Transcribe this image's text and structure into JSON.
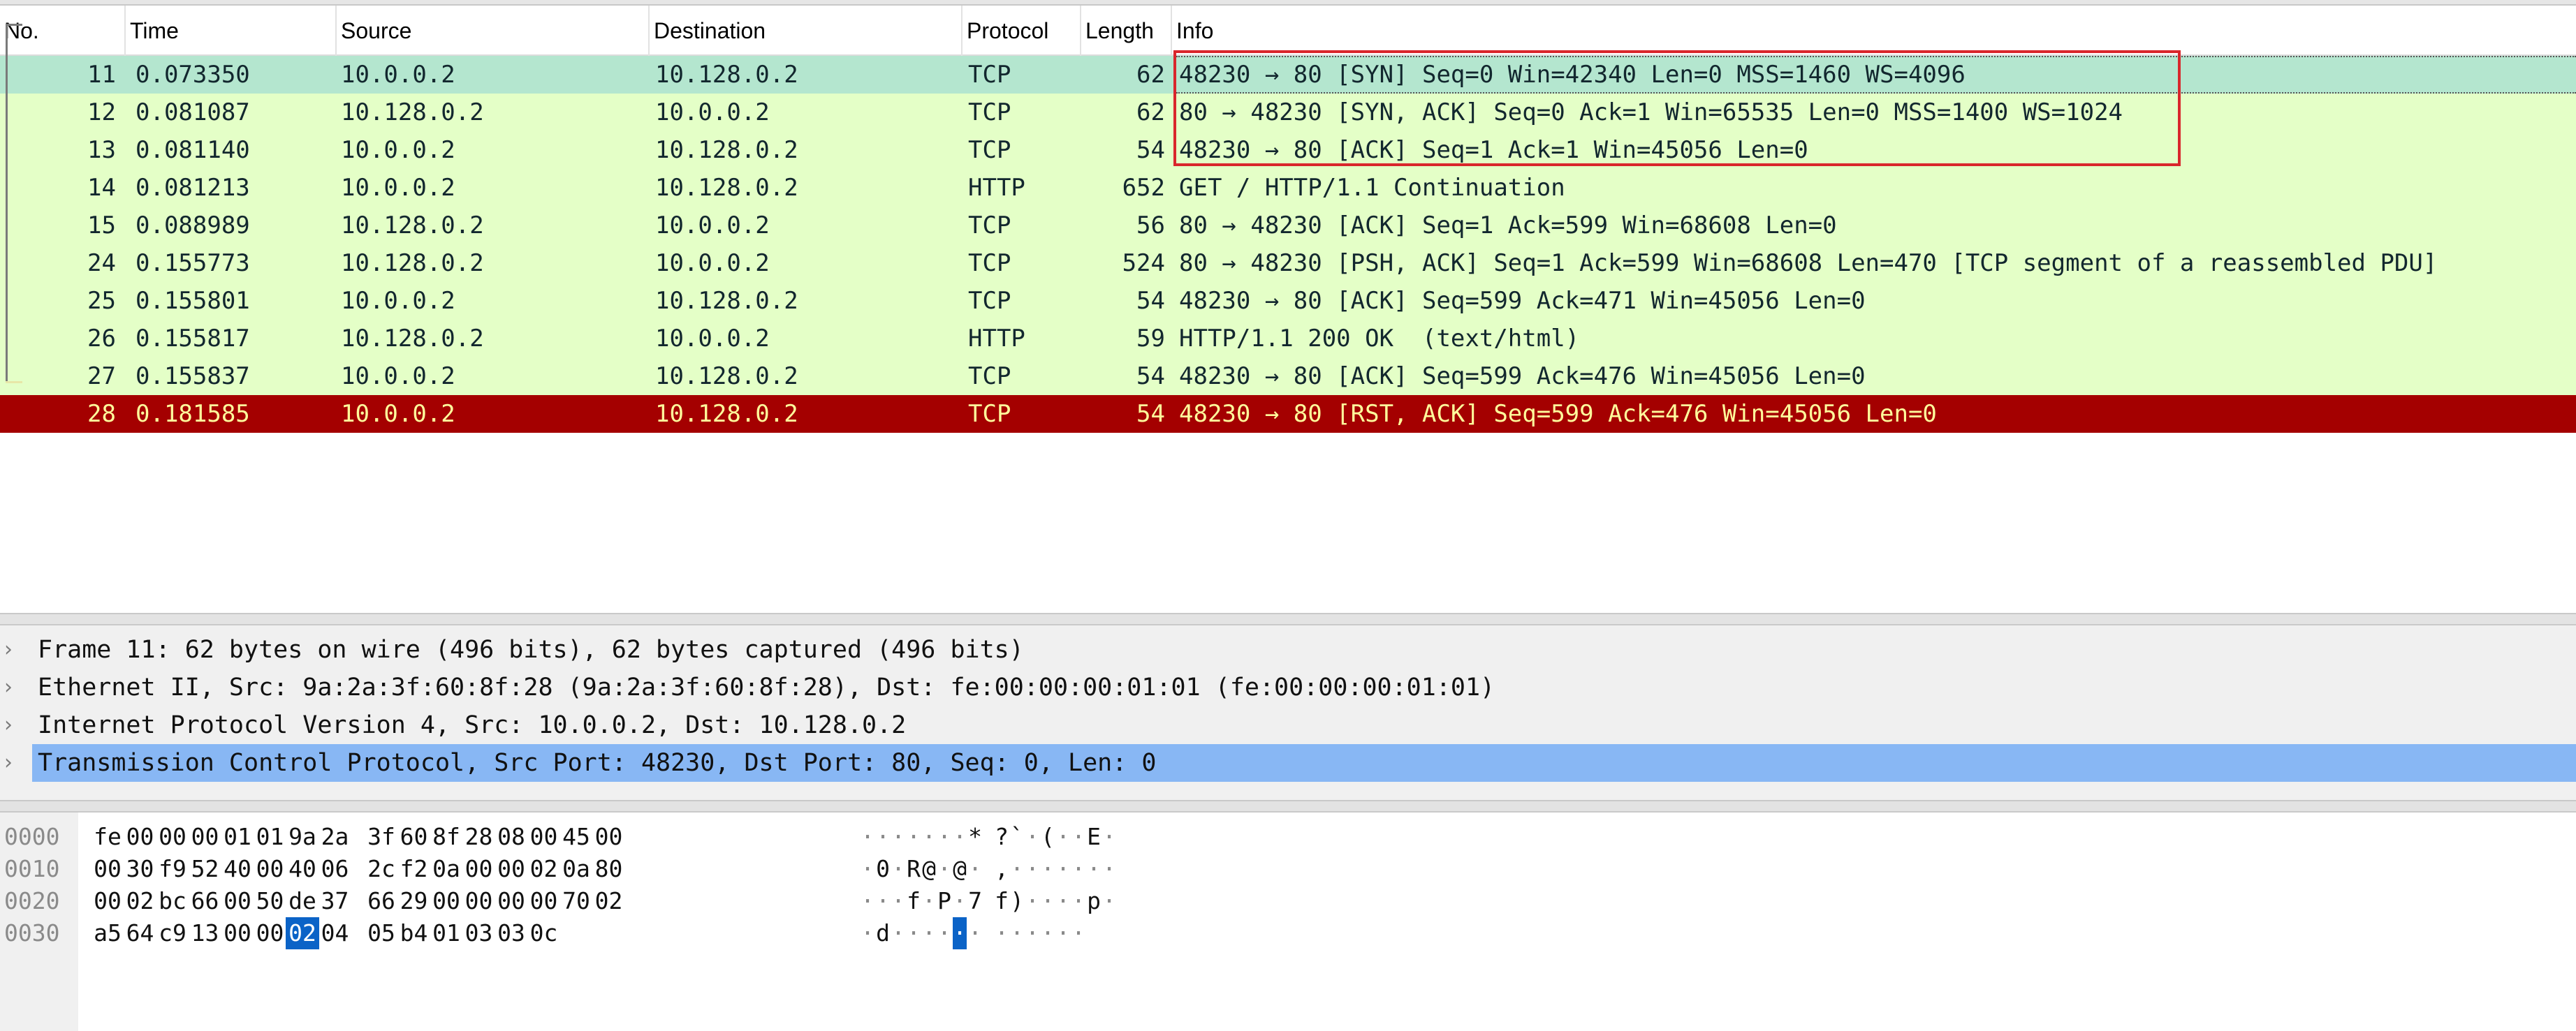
{
  "columns": [
    "No.",
    "Time",
    "Source",
    "Destination",
    "Protocol",
    "Length",
    "Info"
  ],
  "packets": [
    {
      "no": "11",
      "time": "0.073350",
      "src": "10.0.0.2",
      "dst": "10.128.0.2",
      "proto": "TCP",
      "len": "62",
      "info": "48230 → 80 [SYN] Seq=0 Win=42340 Len=0 MSS=1460 WS=4096",
      "state": "selected"
    },
    {
      "no": "12",
      "time": "0.081087",
      "src": "10.128.0.2",
      "dst": "10.0.0.2",
      "proto": "TCP",
      "len": "62",
      "info": "80 → 48230 [SYN, ACK] Seq=0 Ack=1 Win=65535 Len=0 MSS=1400 WS=1024",
      "state": "normal"
    },
    {
      "no": "13",
      "time": "0.081140",
      "src": "10.0.0.2",
      "dst": "10.128.0.2",
      "proto": "TCP",
      "len": "54",
      "info": "48230 → 80 [ACK] Seq=1 Ack=1 Win=45056 Len=0",
      "state": "normal"
    },
    {
      "no": "14",
      "time": "0.081213",
      "src": "10.0.0.2",
      "dst": "10.128.0.2",
      "proto": "HTTP",
      "len": "652",
      "info": "GET / HTTP/1.1 Continuation",
      "state": "normal"
    },
    {
      "no": "15",
      "time": "0.088989",
      "src": "10.128.0.2",
      "dst": "10.0.0.2",
      "proto": "TCP",
      "len": "56",
      "info": "80 → 48230 [ACK] Seq=1 Ack=599 Win=68608 Len=0",
      "state": "normal"
    },
    {
      "no": "24",
      "time": "0.155773",
      "src": "10.128.0.2",
      "dst": "10.0.0.2",
      "proto": "TCP",
      "len": "524",
      "info": "80 → 48230 [PSH, ACK] Seq=1 Ack=599 Win=68608 Len=470 [TCP segment of a reassembled PDU]",
      "state": "normal"
    },
    {
      "no": "25",
      "time": "0.155801",
      "src": "10.0.0.2",
      "dst": "10.128.0.2",
      "proto": "TCP",
      "len": "54",
      "info": "48230 → 80 [ACK] Seq=599 Ack=471 Win=45056 Len=0",
      "state": "normal"
    },
    {
      "no": "26",
      "time": "0.155817",
      "src": "10.128.0.2",
      "dst": "10.0.0.2",
      "proto": "HTTP",
      "len": "59",
      "info": "HTTP/1.1 200 OK  (text/html)",
      "state": "normal"
    },
    {
      "no": "27",
      "time": "0.155837",
      "src": "10.0.0.2",
      "dst": "10.128.0.2",
      "proto": "TCP",
      "len": "54",
      "info": "48230 → 80 [ACK] Seq=599 Ack=476 Win=45056 Len=0",
      "state": "normal"
    },
    {
      "no": "28",
      "time": "0.181585",
      "src": "10.0.0.2",
      "dst": "10.128.0.2",
      "proto": "TCP",
      "len": "54",
      "info": "48230 → 80 [RST, ACK] Seq=599 Ack=476 Win=45056 Len=0",
      "state": "rst"
    }
  ],
  "details": [
    {
      "text": "Frame 11: 62 bytes on wire (496 bits), 62 bytes captured (496 bits)",
      "selected": false
    },
    {
      "text": "Ethernet II, Src: 9a:2a:3f:60:8f:28 (9a:2a:3f:60:8f:28), Dst: fe:00:00:00:01:01 (fe:00:00:00:01:01)",
      "selected": false
    },
    {
      "text": "Internet Protocol Version 4, Src: 10.0.0.2, Dst: 10.128.0.2",
      "selected": false
    },
    {
      "text": "Transmission Control Protocol, Src Port: 48230, Dst Port: 80, Seq: 0, Len: 0",
      "selected": true
    }
  ],
  "expander_glyph": "›",
  "hex_rows": [
    {
      "offset": "0000",
      "bytes": [
        "fe",
        "00",
        "00",
        "00",
        "01",
        "01",
        "9a",
        "2a",
        "3f",
        "60",
        "8f",
        "28",
        "08",
        "00",
        "45",
        "00"
      ],
      "ascii": [
        "·",
        "·",
        "·",
        "·",
        "·",
        "·",
        "·",
        "*",
        "?",
        "`",
        "·",
        "(",
        "·",
        "·",
        "E",
        "·"
      ]
    },
    {
      "offset": "0010",
      "bytes": [
        "00",
        "30",
        "f9",
        "52",
        "40",
        "00",
        "40",
        "06",
        "2c",
        "f2",
        "0a",
        "00",
        "00",
        "02",
        "0a",
        "80"
      ],
      "ascii": [
        "·",
        "0",
        "·",
        "R",
        "@",
        "·",
        "@",
        "·",
        ",",
        "·",
        "·",
        "·",
        "·",
        "·",
        "·",
        "·"
      ]
    },
    {
      "offset": "0020",
      "bytes": [
        "00",
        "02",
        "bc",
        "66",
        "00",
        "50",
        "de",
        "37",
        "66",
        "29",
        "00",
        "00",
        "00",
        "00",
        "70",
        "02"
      ],
      "ascii": [
        "·",
        "·",
        "·",
        "f",
        "·",
        "P",
        "·",
        "7",
        "f",
        ")",
        "·",
        "·",
        "·",
        "·",
        "p",
        "·"
      ]
    },
    {
      "offset": "0030",
      "bytes": [
        "a5",
        "64",
        "c9",
        "13",
        "00",
        "00",
        "02",
        "04",
        "05",
        "b4",
        "01",
        "03",
        "03",
        "0c"
      ],
      "ascii": [
        "·",
        "d",
        "·",
        "·",
        "·",
        "·",
        "·",
        "·",
        "·",
        "·",
        "·",
        "·",
        "·",
        "·"
      ]
    }
  ],
  "hex_highlight": {
    "row": 3,
    "index": 6
  },
  "colors": {
    "row_normal": "#e4ffc7",
    "row_selected": "#b4e6cf",
    "row_rst": "#a40000",
    "rst_text": "#fffc9c",
    "highlight_box": "#d9262c",
    "detail_selected": "#88b7f4",
    "hex_selected": "#0b63c7"
  }
}
